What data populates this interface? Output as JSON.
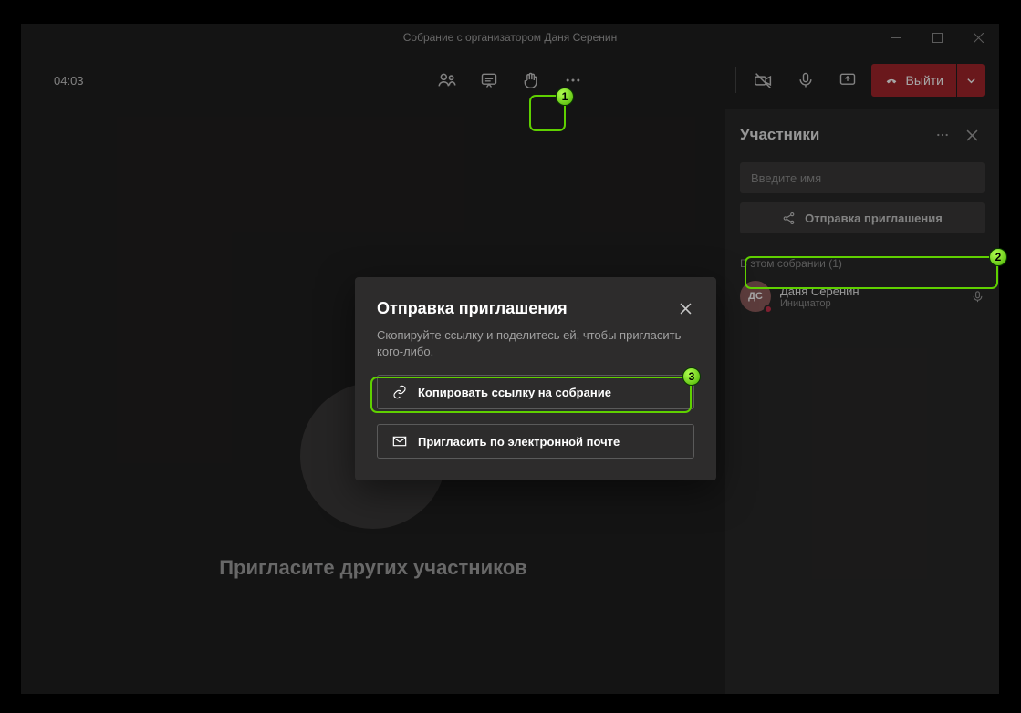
{
  "window": {
    "title": "Собрание с организатором Даня Серенин"
  },
  "toolbar": {
    "timer": "04:03",
    "leave_label": "Выйти"
  },
  "main": {
    "invite_others": "Пригласите других участников"
  },
  "panel": {
    "title": "Участники",
    "search_placeholder": "Введите имя",
    "share_invite": "Отправка приглашения",
    "section_header": "В этом собрании (1)",
    "participant": {
      "initials": "ДС",
      "name": "Даня Серенин",
      "role": "Инициатор"
    }
  },
  "modal": {
    "title": "Отправка приглашения",
    "subtitle": "Скопируйте ссылку и поделитесь ей, чтобы пригласить кого-либо.",
    "copy_link": "Копировать ссылку на собрание",
    "email_invite": "Пригласить по электронной почте"
  },
  "callouts": {
    "one": "1",
    "two": "2",
    "three": "3"
  }
}
